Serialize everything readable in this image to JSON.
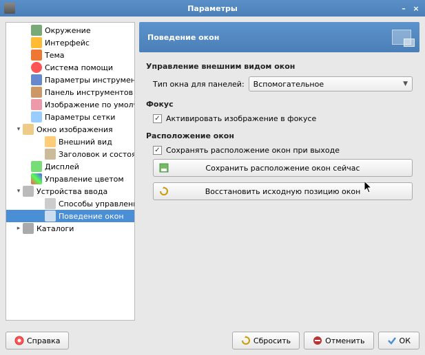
{
  "window": {
    "title": "Параметры"
  },
  "sidebar": {
    "items": [
      {
        "label": "Окружение",
        "level": 0
      },
      {
        "label": "Интерфейс",
        "level": 0
      },
      {
        "label": "Тема",
        "level": 0
      },
      {
        "label": "Система помощи",
        "level": 0
      },
      {
        "label": "Параметры инструментов",
        "level": 0
      },
      {
        "label": "Панель инструментов",
        "level": 0
      },
      {
        "label": "Изображение по умолчанию",
        "level": 0
      },
      {
        "label": "Параметры сетки",
        "level": 0
      },
      {
        "label": "Окно изображения",
        "level": 0,
        "expander": "▾"
      },
      {
        "label": "Внешний вид",
        "level": 1
      },
      {
        "label": "Заголовок и состояние",
        "level": 1
      },
      {
        "label": "Дисплей",
        "level": 0
      },
      {
        "label": "Управление цветом",
        "level": 0
      },
      {
        "label": "Устройства ввода",
        "level": 0,
        "expander": "▾"
      },
      {
        "label": "Способы управления",
        "level": 1
      },
      {
        "label": "Поведение окон",
        "level": 1,
        "selected": true
      },
      {
        "label": "Каталоги",
        "level": 0,
        "expander": "▸"
      }
    ]
  },
  "panel": {
    "title": "Поведение окон",
    "sections": {
      "appearance": {
        "title": "Управление внешним видом окон",
        "type_label": "Тип окна для панелей:",
        "type_value": "Вспомогательное"
      },
      "focus": {
        "title": "Фокус",
        "activate_label": "Активировать изображение в фокусе",
        "activate_checked": true
      },
      "layout": {
        "title": "Расположение окон",
        "save_on_exit_label": "Сохранять расположение окон при выходе",
        "save_on_exit_checked": true,
        "save_now_btn": "Сохранить расположение окон сейчас",
        "restore_btn": "Восстановить исходную позицию окон"
      }
    }
  },
  "footer": {
    "help": "Справка",
    "reset": "Сбросить",
    "cancel": "Отменить",
    "ok": "ОК"
  }
}
